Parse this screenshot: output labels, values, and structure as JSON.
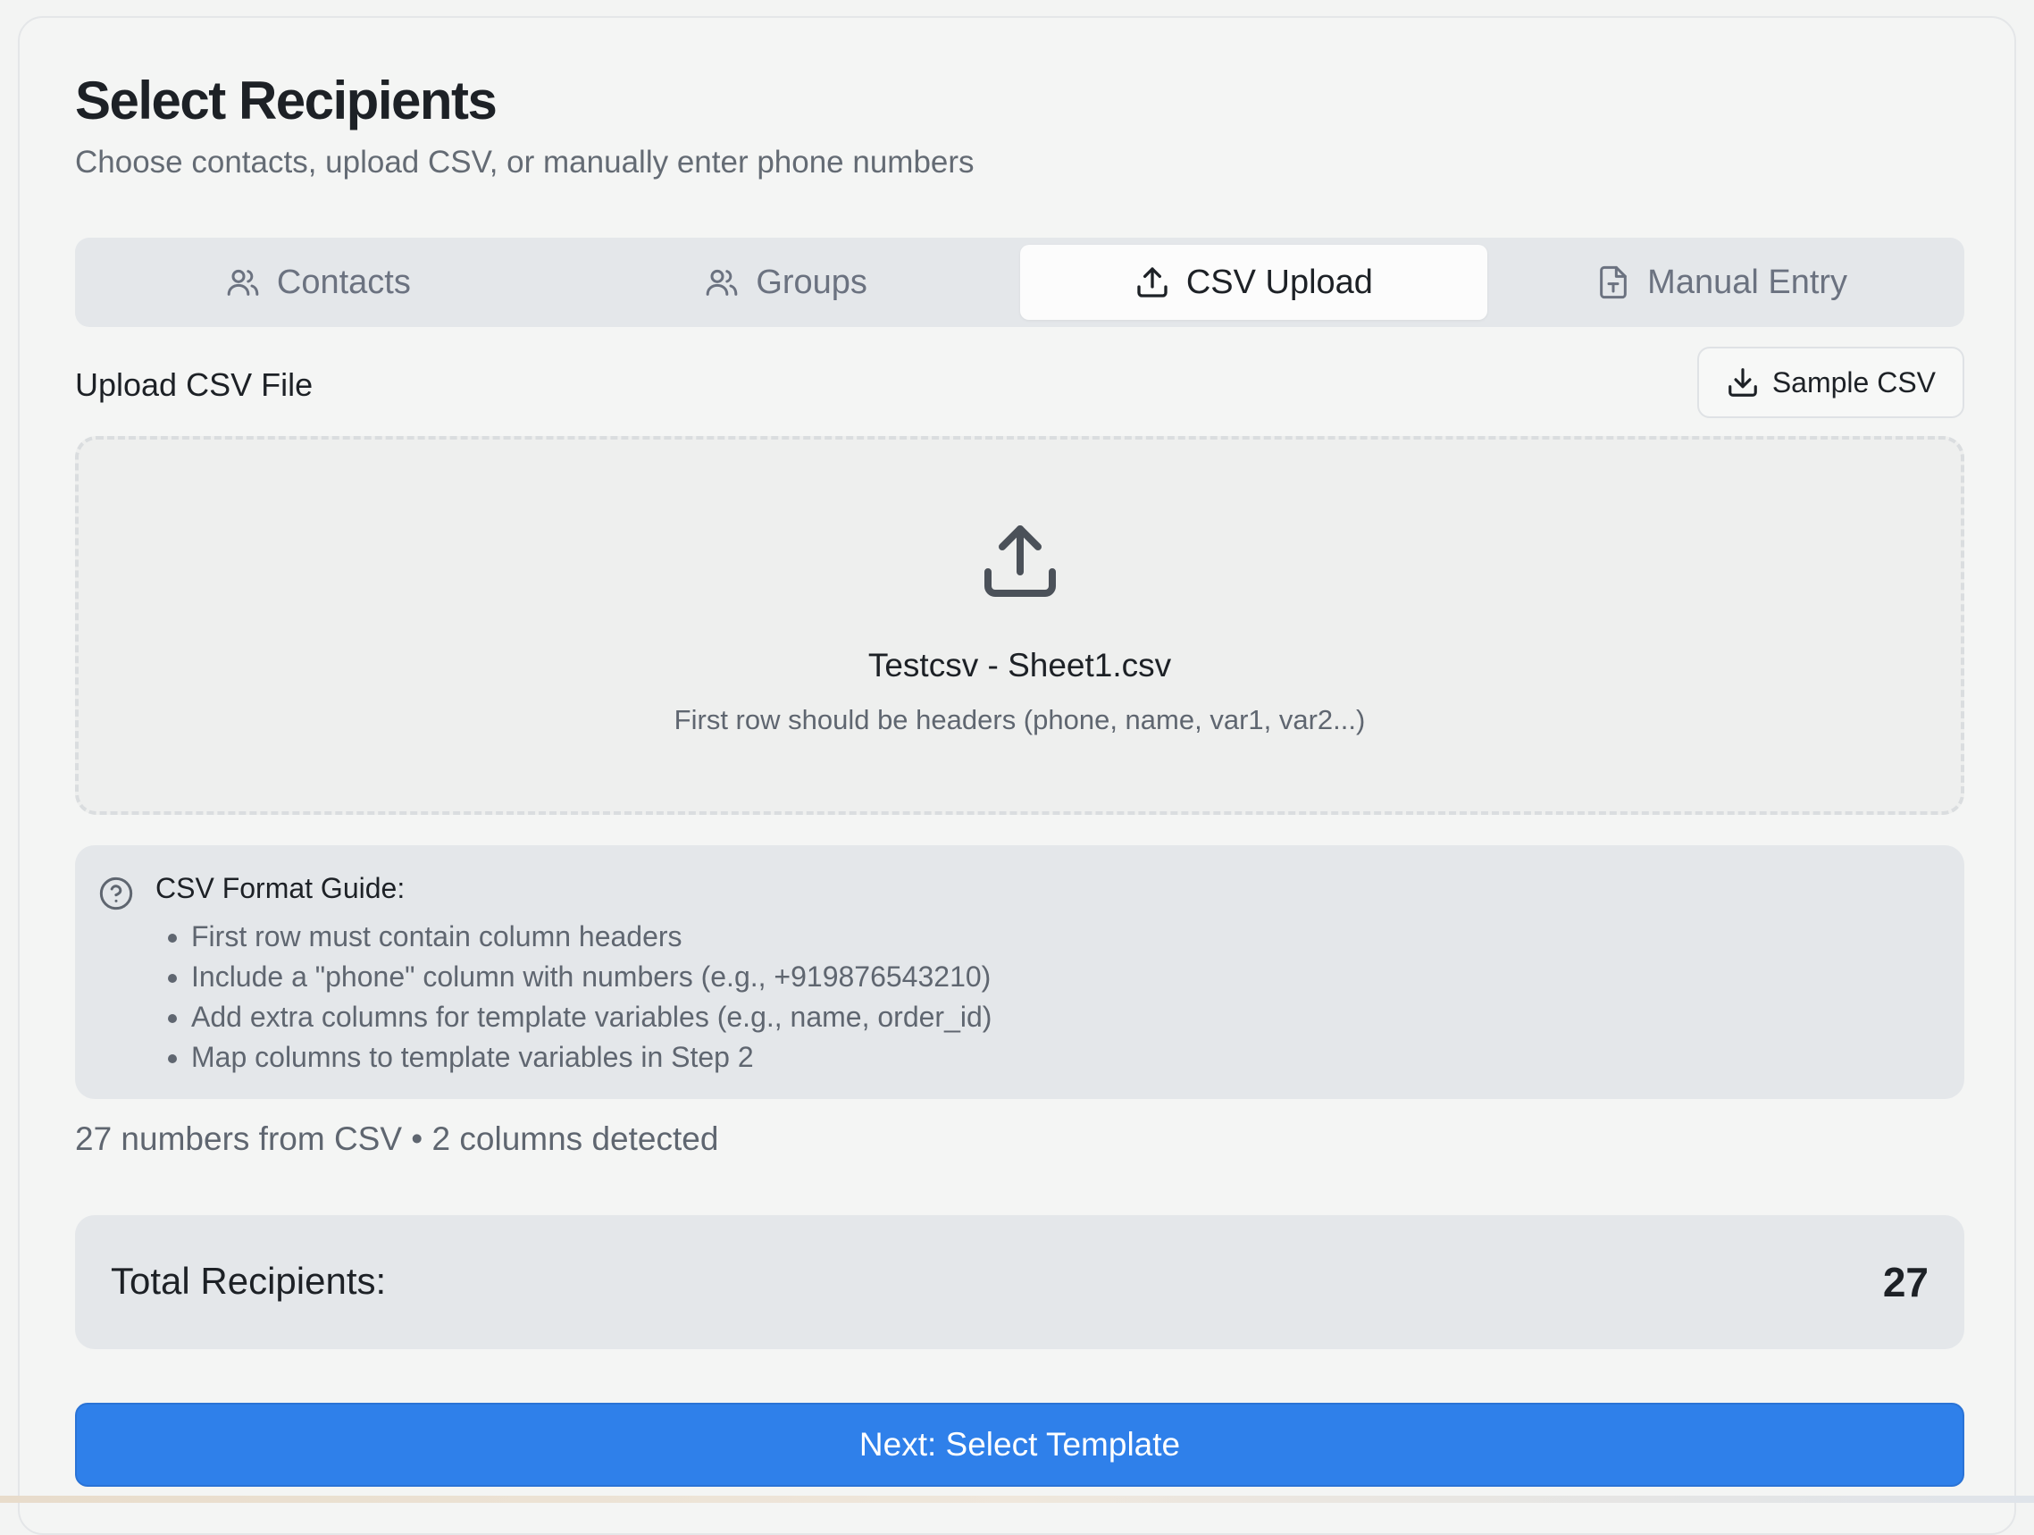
{
  "header": {
    "title": "Select Recipients",
    "subtitle": "Choose contacts, upload CSV, or manually enter phone numbers"
  },
  "tabs": [
    {
      "label": "Contacts",
      "icon": "users-icon",
      "active": false
    },
    {
      "label": "Groups",
      "icon": "users-icon",
      "active": false
    },
    {
      "label": "CSV Upload",
      "icon": "upload-icon",
      "active": true
    },
    {
      "label": "Manual Entry",
      "icon": "file-text-icon",
      "active": false
    }
  ],
  "upload": {
    "label": "Upload CSV File",
    "sample_button": "Sample CSV",
    "file_name": "Testcsv - Sheet1.csv",
    "hint": "First row should be headers (phone, name, var1, var2...)"
  },
  "guide": {
    "title": "CSV Format Guide:",
    "items": [
      "First row must contain column headers",
      "Include a \"phone\" column with numbers (e.g., +919876543210)",
      "Add extra columns for template variables (e.g., name, order_id)",
      "Map columns to template variables in Step 2"
    ]
  },
  "stats": {
    "summary": "27 numbers from CSV • 2 columns detected"
  },
  "total": {
    "label": "Total Recipients:",
    "value": "27"
  },
  "actions": {
    "next_label": "Next: Select Template"
  },
  "colors": {
    "accent": "#2f80ea",
    "panel": "#e4e7ea"
  }
}
